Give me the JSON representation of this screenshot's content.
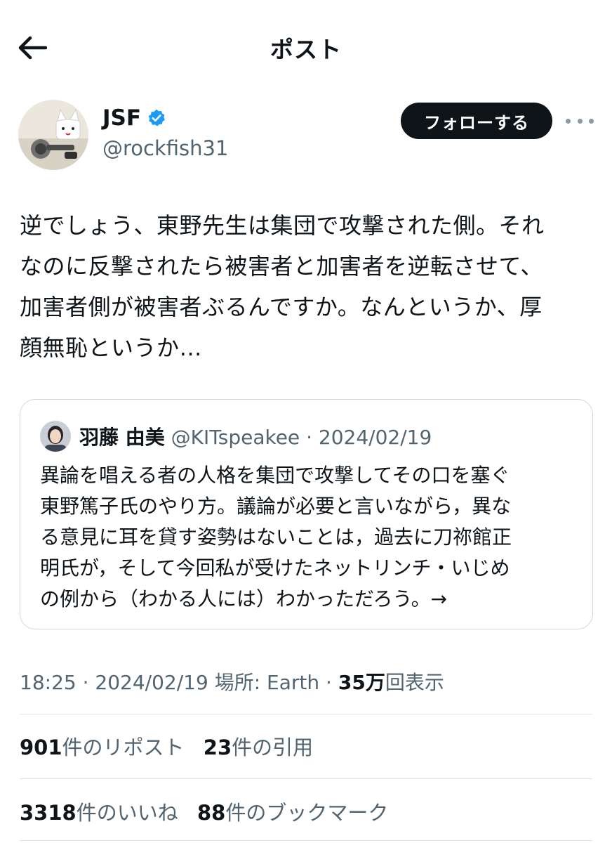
{
  "header": {
    "title": "ポスト"
  },
  "author": {
    "display_name": "JSF",
    "handle": "@rockfish31",
    "verified": true,
    "follow_label": "フォローする"
  },
  "tweet": {
    "lines": [
      "逆でしょう、東野先生は集団で攻撃された側。それ",
      "なのに反撃されたら被害者と加害者を逆転させて、",
      "加害者側が被害者ぶるんですか。なんというか、厚",
      "顔無恥というか…"
    ]
  },
  "quote": {
    "name": "羽藤 由美",
    "handle": "@KITspeakee",
    "separator": "·",
    "date": "2024/02/19",
    "lines": [
      "異論を唱える者の人格を集団で攻撃してその口を塞ぐ",
      "東野篤子氏のやり方。議論が必要と言いながら，異な",
      "る意見に耳を貸す姿勢はないことは，過去に刀祢館正",
      "明氏が，そして今回私が受けたネットリンチ・いじめ",
      "の例から（わかる人には）わかっただろう。→"
    ]
  },
  "meta": {
    "time": "18:25",
    "sep1": "·",
    "date": "2024/02/19",
    "location": "場所: Earth",
    "sep2": "·",
    "views_count": "35万",
    "views_label": "回表示"
  },
  "stats": {
    "reposts_count": "901",
    "reposts_label": "件のリポスト",
    "quotes_count": "23",
    "quotes_label": "件の引用",
    "likes_count": "3318",
    "likes_label": "件のいいね",
    "bookmarks_count": "88",
    "bookmarks_label": "件のブックマーク"
  },
  "colors": {
    "verified": "#1d9bf0",
    "text": "#0f1419",
    "secondary": "#536471",
    "border": "#cfd9de"
  },
  "icons": {
    "back": "arrow-left-icon",
    "verified": "verified-badge-icon",
    "more": "more-horizontal-icon"
  }
}
